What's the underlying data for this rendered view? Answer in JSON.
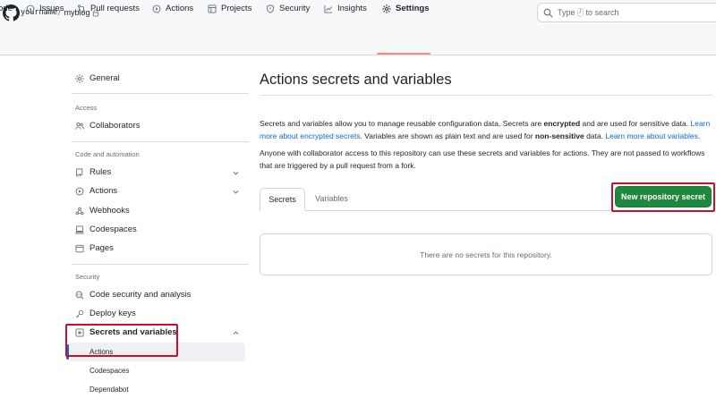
{
  "header": {
    "owner": "yourname",
    "separator": "/",
    "repo": "myblog",
    "search_placeholder_prefix": "Type",
    "search_key": "/",
    "search_placeholder_suffix": "to search"
  },
  "repo_tabs": [
    {
      "label": "Code",
      "visible_label": "ode",
      "icon": "code-icon"
    },
    {
      "label": "Issues",
      "icon": "issue-icon"
    },
    {
      "label": "Pull requests",
      "icon": "pull-request-icon"
    },
    {
      "label": "Actions",
      "icon": "play-icon"
    },
    {
      "label": "Projects",
      "icon": "table-icon"
    },
    {
      "label": "Security",
      "icon": "shield-icon"
    },
    {
      "label": "Insights",
      "icon": "graph-icon"
    },
    {
      "label": "Settings",
      "icon": "gear-icon",
      "selected": true
    }
  ],
  "sidebar": {
    "general": "General",
    "access_heading": "Access",
    "collaborators": "Collaborators",
    "code_automation_heading": "Code and automation",
    "rules": "Rules",
    "actions": "Actions",
    "webhooks": "Webhooks",
    "codespaces": "Codespaces",
    "pages": "Pages",
    "security_heading": "Security",
    "code_security": "Code security and analysis",
    "deploy_keys": "Deploy keys",
    "secrets_variables": "Secrets and variables",
    "sub_actions": "Actions",
    "sub_codespaces": "Codespaces",
    "sub_dependabot": "Dependabot"
  },
  "main": {
    "title": "Actions secrets and variables",
    "p1_a": "Secrets and variables allow you to manage reusable configuration data. Secrets are ",
    "p1_b": "encrypted",
    "p1_c": " and are used for sensitive data. ",
    "p1_link1": "Learn more about encrypted secrets",
    "p1_d": ". Variables are shown as plain text and are used for ",
    "p1_e": "non-sensitive",
    "p1_f": " data. ",
    "p1_link2": "Learn more about variables",
    "p1_g": ".",
    "p2": "Anyone with collaborator access to this repository can use these secrets and variables for actions. They are not passed to workflows that are triggered by a pull request from a fork.",
    "tab_secrets": "Secrets",
    "tab_variables": "Variables",
    "new_secret_button": "New repository secret",
    "empty_message": "There are no secrets for this repository."
  },
  "colors": {
    "primary_button": "#1f883d",
    "link": "#0969da",
    "selected_tab_underline": "#fd8c73",
    "highlight_box": "#c8102e"
  }
}
